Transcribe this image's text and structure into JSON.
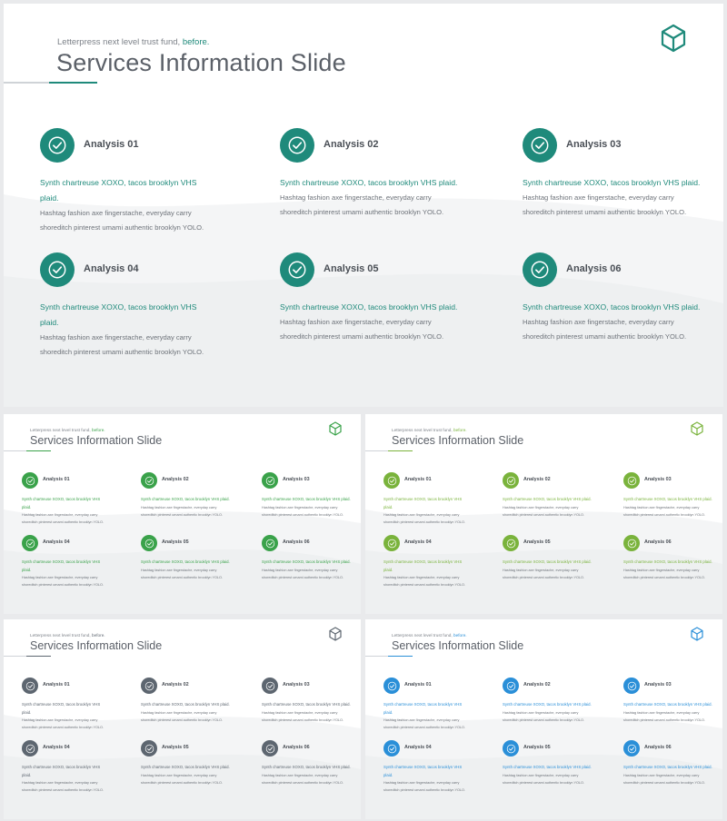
{
  "slides": [
    {
      "id": "main-teal",
      "accent": "#1f8a7b",
      "pre_text": "Letterpress next level trust fund, ",
      "pre_highlight": "before.",
      "title": "Services Information Slide",
      "items": [
        {
          "label": "Analysis 01",
          "accent_text": "Synth chartreuse XOXO, tacos brooklyn VHS plaid.",
          "body": "Hashtag fashion axe fingerstache, everyday carry shoreditch pinterest umami authentic brooklyn YOLO."
        },
        {
          "label": "Analysis 02",
          "accent_text": "Synth chartreuse XOXO, tacos brooklyn VHS plaid.",
          "body": "Hashtag fashion axe fingerstache, everyday carry shoreditch pinterest umami authentic brooklyn YOLO."
        },
        {
          "label": "Analysis 03",
          "accent_text": "Synth chartreuse XOXO, tacos brooklyn VHS plaid.",
          "body": "Hashtag fashion axe fingerstache, everyday carry shoreditch pinterest umami authentic brooklyn YOLO."
        },
        {
          "label": "Analysis 04",
          "accent_text": "Synth chartreuse XOXO, tacos brooklyn VHS plaid.",
          "body": "Hashtag fashion axe fingerstache, everyday carry shoreditch pinterest umami authentic brooklyn YOLO."
        },
        {
          "label": "Analysis 05",
          "accent_text": "Synth chartreuse XOXO, tacos brooklyn VHS plaid.",
          "body": "Hashtag fashion axe fingerstache, everyday carry shoreditch pinterest umami authentic brooklyn YOLO."
        },
        {
          "label": "Analysis 06",
          "accent_text": "Synth chartreuse XOXO, tacos brooklyn VHS plaid.",
          "body": "Hashtag fashion axe fingerstache, everyday carry shoreditch pinterest umami authentic brooklyn YOLO."
        }
      ]
    },
    {
      "id": "small-green",
      "accent": "#3aa24a",
      "pre_text": "Letterpress next level trust fund, ",
      "pre_highlight": "before.",
      "title": "Services Information Slide",
      "items": [
        {
          "label": "Analysis 01",
          "accent_text": "Synth chartreuse XOXO, tacos brooklyn VHS plaid.",
          "body": "Hashtag fashion axe fingerstache, everyday carry shoreditch pinterest umami authentic brooklyn YOLO."
        },
        {
          "label": "Analysis 02",
          "accent_text": "Synth chartreuse XOXO, tacos brooklyn VHS plaid.",
          "body": "Hashtag fashion axe fingerstache, everyday carry shoreditch pinterest umami authentic brooklyn YOLO."
        },
        {
          "label": "Analysis 03",
          "accent_text": "Synth chartreuse XOXO, tacos brooklyn VHS plaid.",
          "body": "Hashtag fashion axe fingerstache, everyday carry shoreditch pinterest umami authentic brooklyn YOLO."
        },
        {
          "label": "Analysis 04",
          "accent_text": "Synth chartreuse XOXO, tacos brooklyn VHS plaid.",
          "body": "Hashtag fashion axe fingerstache, everyday carry shoreditch pinterest umami authentic brooklyn YOLO."
        },
        {
          "label": "Analysis 05",
          "accent_text": "Synth chartreuse XOXO, tacos brooklyn VHS plaid.",
          "body": "Hashtag fashion axe fingerstache, everyday carry shoreditch pinterest umami authentic brooklyn YOLO."
        },
        {
          "label": "Analysis 06",
          "accent_text": "Synth chartreuse XOXO, tacos brooklyn VHS plaid.",
          "body": "Hashtag fashion axe fingerstache, everyday carry shoreditch pinterest umami authentic brooklyn YOLO."
        }
      ]
    },
    {
      "id": "small-lime",
      "accent": "#7ab33c",
      "pre_text": "Letterpress next level trust fund, ",
      "pre_highlight": "before.",
      "title": "Services Information Slide",
      "items": [
        {
          "label": "Analysis 01",
          "accent_text": "Synth chartreuse XOXO, tacos brooklyn VHS plaid.",
          "body": "Hashtag fashion axe fingerstache, everyday carry shoreditch pinterest umami authentic brooklyn YOLO."
        },
        {
          "label": "Analysis 02",
          "accent_text": "Synth chartreuse XOXO, tacos brooklyn VHS plaid.",
          "body": "Hashtag fashion axe fingerstache, everyday carry shoreditch pinterest umami authentic brooklyn YOLO."
        },
        {
          "label": "Analysis 03",
          "accent_text": "Synth chartreuse XOXO, tacos brooklyn VHS plaid.",
          "body": "Hashtag fashion axe fingerstache, everyday carry shoreditch pinterest umami authentic brooklyn YOLO."
        },
        {
          "label": "Analysis 04",
          "accent_text": "Synth chartreuse XOXO, tacos brooklyn VHS plaid.",
          "body": "Hashtag fashion axe fingerstache, everyday carry shoreditch pinterest umami authentic brooklyn YOLO."
        },
        {
          "label": "Analysis 05",
          "accent_text": "Synth chartreuse XOXO, tacos brooklyn VHS plaid.",
          "body": "Hashtag fashion axe fingerstache, everyday carry shoreditch pinterest umami authentic brooklyn YOLO."
        },
        {
          "label": "Analysis 06",
          "accent_text": "Synth chartreuse XOXO, tacos brooklyn VHS plaid.",
          "body": "Hashtag fashion axe fingerstache, everyday carry shoreditch pinterest umami authentic brooklyn YOLO."
        }
      ]
    },
    {
      "id": "small-grey",
      "accent": "#5d6670",
      "pre_text": "Letterpress next level trust fund, ",
      "pre_highlight": "before.",
      "title": "Services Information Slide",
      "items": [
        {
          "label": "Analysis 01",
          "accent_text": "Synth chartreuse XOXO, tacos brooklyn VHS plaid.",
          "body": "Hashtag fashion axe fingerstache, everyday carry shoreditch pinterest umami authentic brooklyn YOLO."
        },
        {
          "label": "Analysis 02",
          "accent_text": "Synth chartreuse XOXO, tacos brooklyn VHS plaid.",
          "body": "Hashtag fashion axe fingerstache, everyday carry shoreditch pinterest umami authentic brooklyn YOLO."
        },
        {
          "label": "Analysis 03",
          "accent_text": "Synth chartreuse XOXO, tacos brooklyn VHS plaid.",
          "body": "Hashtag fashion axe fingerstache, everyday carry shoreditch pinterest umami authentic brooklyn YOLO."
        },
        {
          "label": "Analysis 04",
          "accent_text": "Synth chartreuse XOXO, tacos brooklyn VHS plaid.",
          "body": "Hashtag fashion axe fingerstache, everyday carry shoreditch pinterest umami authentic brooklyn YOLO."
        },
        {
          "label": "Analysis 05",
          "accent_text": "Synth chartreuse XOXO, tacos brooklyn VHS plaid.",
          "body": "Hashtag fashion axe fingerstache, everyday carry shoreditch pinterest umami authentic brooklyn YOLO."
        },
        {
          "label": "Analysis 06",
          "accent_text": "Synth chartreuse XOXO, tacos brooklyn VHS plaid.",
          "body": "Hashtag fashion axe fingerstache, everyday carry shoreditch pinterest umami authentic brooklyn YOLO."
        }
      ]
    },
    {
      "id": "small-blue",
      "accent": "#2a8fd8",
      "pre_text": "Letterpress next level trust fund, ",
      "pre_highlight": "before.",
      "title": "Services Information Slide",
      "items": [
        {
          "label": "Analysis 01",
          "accent_text": "Synth chartreuse XOXO, tacos brooklyn VHS plaid.",
          "body": "Hashtag fashion axe fingerstache, everyday carry shoreditch pinterest umami authentic brooklyn YOLO."
        },
        {
          "label": "Analysis 02",
          "accent_text": "Synth chartreuse XOXO, tacos brooklyn VHS plaid.",
          "body": "Hashtag fashion axe fingerstache, everyday carry shoreditch pinterest umami authentic brooklyn YOLO."
        },
        {
          "label": "Analysis 03",
          "accent_text": "Synth chartreuse XOXO, tacos brooklyn VHS plaid.",
          "body": "Hashtag fashion axe fingerstache, everyday carry shoreditch pinterest umami authentic brooklyn YOLO."
        },
        {
          "label": "Analysis 04",
          "accent_text": "Synth chartreuse XOXO, tacos brooklyn VHS plaid.",
          "body": "Hashtag fashion axe fingerstache, everyday carry shoreditch pinterest umami authentic brooklyn YOLO."
        },
        {
          "label": "Analysis 05",
          "accent_text": "Synth chartreuse XOXO, tacos brooklyn VHS plaid.",
          "body": "Hashtag fashion axe fingerstache, everyday carry shoreditch pinterest umami authentic brooklyn YOLO."
        },
        {
          "label": "Analysis 06",
          "accent_text": "Synth chartreuse XOXO, tacos brooklyn VHS plaid.",
          "body": "Hashtag fashion axe fingerstache, everyday carry shoreditch pinterest umami authentic brooklyn YOLO."
        }
      ]
    }
  ]
}
